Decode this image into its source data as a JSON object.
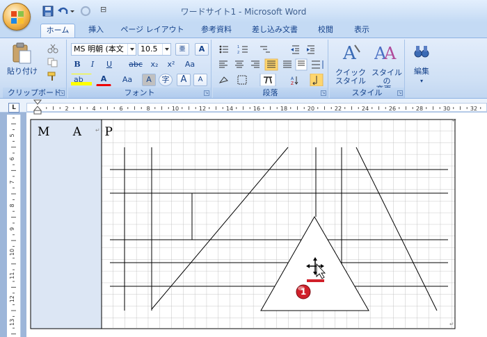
{
  "titlebar": {
    "title": "ワードサイト1 - Microsoft Word",
    "qa_minus": "⊟"
  },
  "tabs": [
    {
      "label": "ホーム",
      "active": true
    },
    {
      "label": "挿入"
    },
    {
      "label": "ページ レイアウト"
    },
    {
      "label": "参考資料"
    },
    {
      "label": "差し込み文書"
    },
    {
      "label": "校閲"
    },
    {
      "label": "表示"
    }
  ],
  "ribbon": {
    "clipboard": {
      "paste_label": "貼り付け",
      "group_label": "クリップボード"
    },
    "font": {
      "font_name": "MS 明朝 (本文",
      "font_size": "10.5",
      "bold": "B",
      "italic": "I",
      "underline": "U",
      "strike": "abc",
      "subscript": "x₂",
      "superscript": "x²",
      "clear_format": "Aa",
      "highlight": "ab",
      "font_color": "A",
      "change_case": "Aa",
      "char_shading": "A",
      "enclose": "字",
      "grow": "A",
      "shrink": "A",
      "group_label": "フォント"
    },
    "paragraph": {
      "group_label": "段落"
    },
    "styles": {
      "quick_style_line1": "クイック",
      "quick_style_line2": "スタイル",
      "change_style_line1": "スタイルの",
      "change_style_line2": "変更",
      "group_label": "スタイル"
    },
    "edit": {
      "label": "編集"
    }
  },
  "ruler": {
    "corner": "L",
    "h_labels": [
      "2",
      "4",
      "6",
      "8",
      "10",
      "12",
      "14",
      "16",
      "18",
      "20",
      "22",
      "24",
      "26",
      "28",
      "30",
      "32"
    ],
    "v_labels": [
      "5",
      "6",
      "7",
      "8",
      "9",
      "10",
      "11",
      "12",
      "13"
    ]
  },
  "document": {
    "map_title": "M A P",
    "callout_number": "1",
    "paragraph_mark": "↵"
  },
  "colors": {
    "ribbon_bg": "#cfe0f5",
    "callout_red": "#d0202a",
    "grid": "#b8b8b8"
  }
}
